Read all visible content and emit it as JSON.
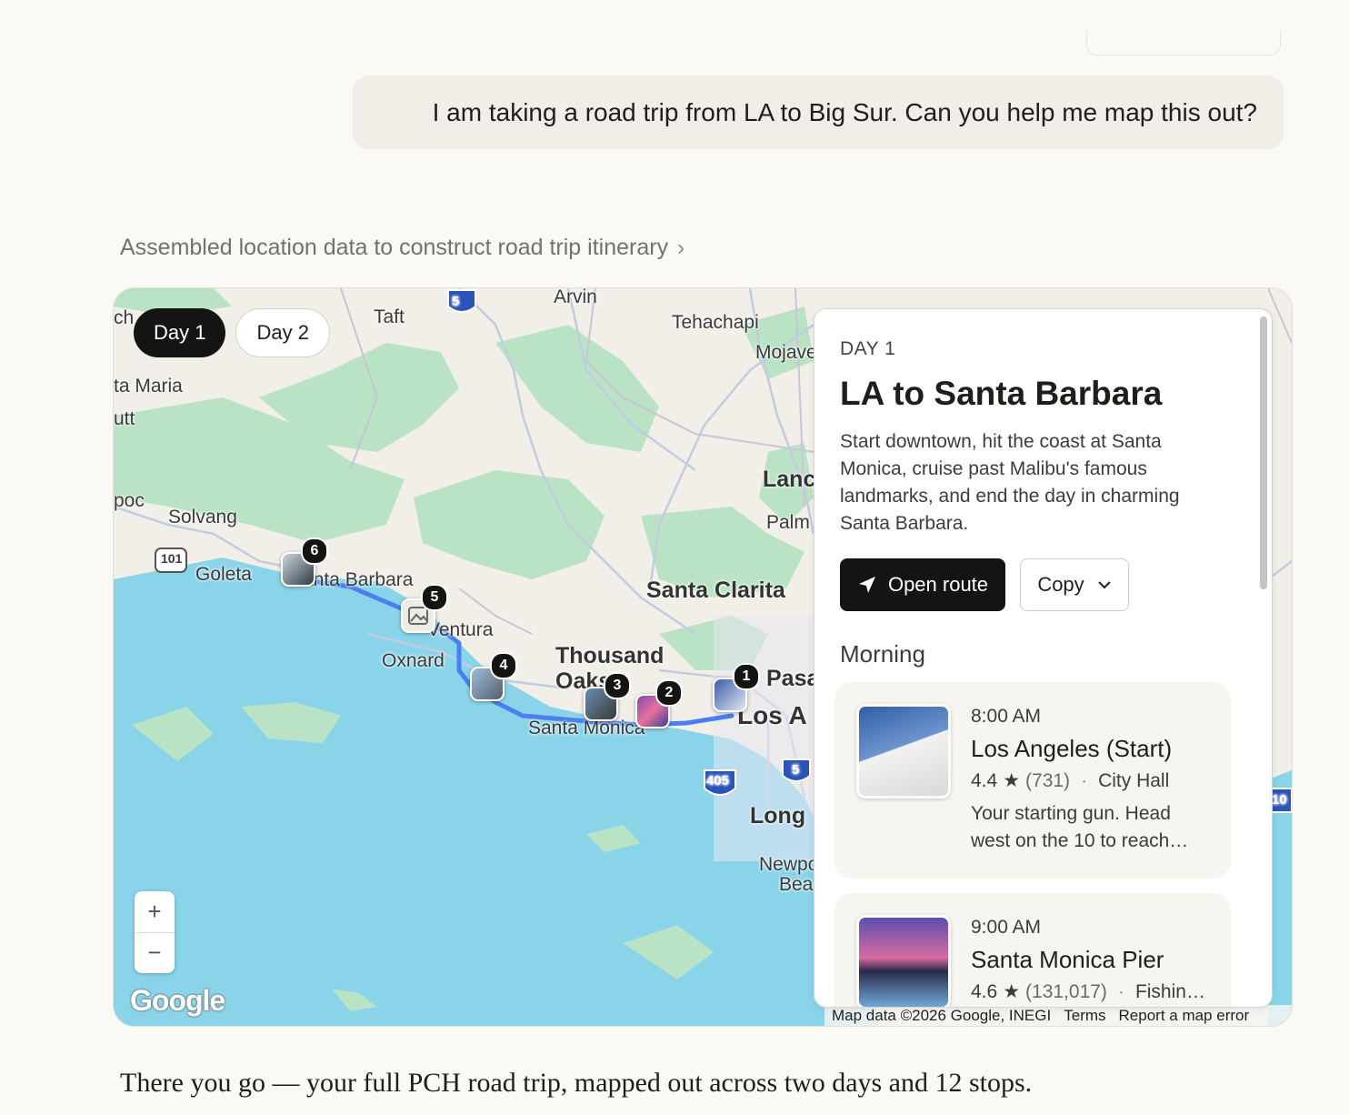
{
  "user_message": "I am taking a road trip from LA to Big Sur. Can you help me map this out?",
  "status_text": "Assembled location data to construct road trip itinerary",
  "map": {
    "day_tabs": [
      {
        "label": "Day 1",
        "active": true
      },
      {
        "label": "Day 2",
        "active": false
      }
    ],
    "places": [
      "Arvin",
      "Taft",
      "Tehachapi",
      "Mojave",
      "ta Maria",
      "utt",
      "poc",
      "Solvang",
      "Goleta",
      "anta Barbara",
      "Ventura",
      "Oxnard",
      "Thousand Oaks",
      "Santa Clarita",
      "Lanc",
      "Palm",
      "Santa Monica",
      "Pasa",
      "Los A",
      "Long",
      "Newpo",
      "Bea",
      "ch"
    ],
    "highway_shields": [
      "5",
      "101",
      "405",
      "5",
      "10"
    ],
    "markers": [
      "1",
      "2",
      "3",
      "4",
      "5",
      "6"
    ],
    "zoom_in": "+",
    "zoom_out": "−",
    "google_logo": "Google",
    "attribution": {
      "data": "Map data ©2026 Google, INEGI",
      "terms": "Terms",
      "report": "Report a map error"
    }
  },
  "panel": {
    "day_label": "DAY 1",
    "title": "LA to Santa Barbara",
    "description": "Start downtown, hit the coast at Santa Monica, cruise past Malibu's famous landmarks, and end the day in charming Santa Barbara.",
    "open_route_label": "Open route",
    "copy_label": "Copy",
    "section": "Morning",
    "stops": [
      {
        "time": "8:00 AM",
        "name": "Los Angeles (Start)",
        "rating": "4.4",
        "reviews": "(731)",
        "category": "City Hall",
        "note": "Your starting gun. Head west on the 10 to reach…"
      },
      {
        "time": "9:00 AM",
        "name": "Santa Monica Pier",
        "rating": "4.6",
        "reviews": "(131,017)",
        "category": "Fishin…",
        "note": ""
      }
    ]
  },
  "assistant_reply": "There you go — your full PCH road trip, mapped out across two days and 12 stops.",
  "colors": {
    "water": "#8ad4ea",
    "land": "#f2efe9",
    "park": "#b9e3c4",
    "route": "#4a7ff0",
    "dark": "#141413"
  }
}
